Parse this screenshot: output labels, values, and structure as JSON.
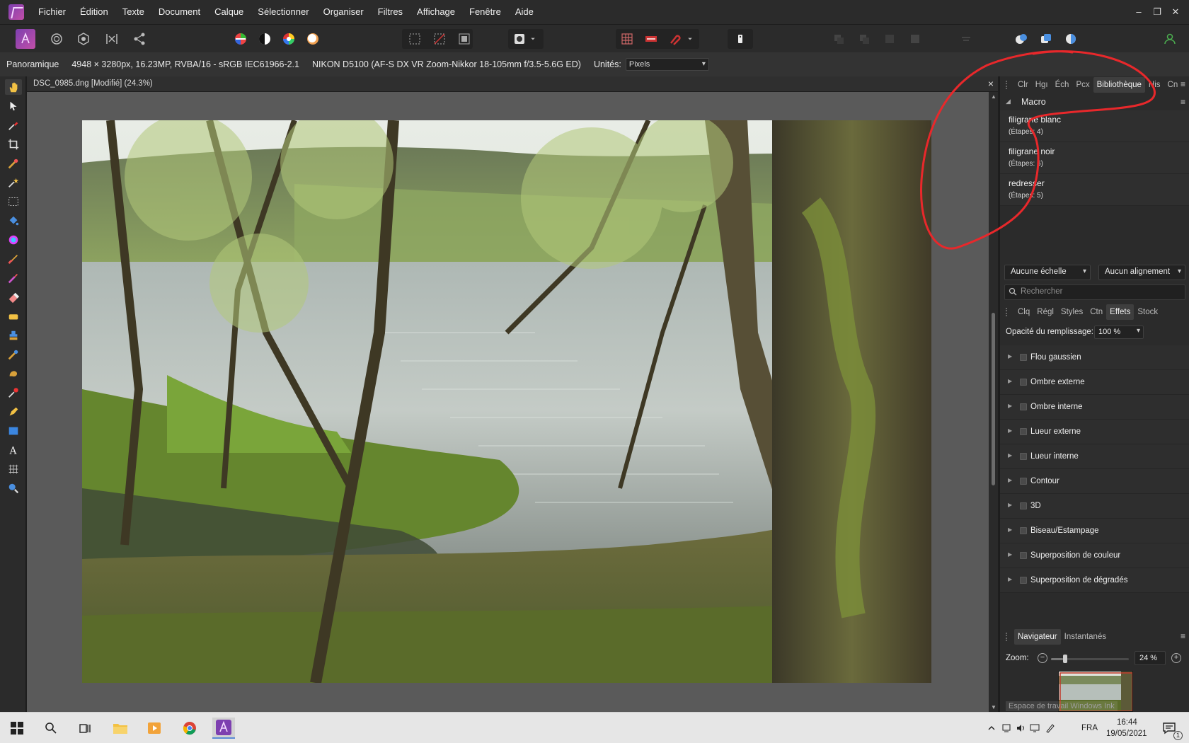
{
  "menu": {
    "items": [
      "Fichier",
      "Édition",
      "Texte",
      "Document",
      "Calque",
      "Sélectionner",
      "Organiser",
      "Filtres",
      "Affichage",
      "Fenêtre",
      "Aide"
    ]
  },
  "window_controls": {
    "minimize": "–",
    "restore": "❐",
    "close": "✕"
  },
  "context": {
    "tool_name": "Panoramique",
    "image_info": "4948 × 3280px, 16.23MP, RVBA/16 - sRGB IEC61966-2.1",
    "camera_info": "NIKON D5100 (AF-S DX VR Zoom-Nikkor 18-105mm f/3.5-5.6G ED)",
    "units_label": "Unités:",
    "units_value": "Pixels"
  },
  "document": {
    "title": "DSC_0985.dng [Modifié] (24.3%)",
    "close": "×"
  },
  "panels": {
    "top_tabs": [
      "Clr",
      "Hgı",
      "Éch",
      "Pcx",
      "Bibliothèque",
      "His",
      "Cn"
    ],
    "top_active": "Bibliothèque",
    "macro_title": "Macro",
    "macros": [
      {
        "name": "filigrane blanc",
        "steps": "(Étapes: 4)"
      },
      {
        "name": "filigrane noir",
        "steps": "(Étapes: 6)"
      },
      {
        "name": "redresser",
        "steps": "(Étapes: 5)"
      }
    ],
    "scale_select": "Aucune échelle",
    "align_select": "Aucun alignement",
    "search_placeholder": "Rechercher",
    "mid_tabs": [
      "Clq",
      "Régl",
      "Styles",
      "Ctn",
      "Effets",
      "Stock"
    ],
    "mid_active": "Effets",
    "fill_opacity_label": "Opacité du remplissage:",
    "fill_opacity_value": "100 %",
    "effects": [
      "Flou gaussien",
      "Ombre externe",
      "Ombre interne",
      "Lueur externe",
      "Lueur interne",
      "Contour",
      "3D",
      "Biseau/Estampage",
      "Superposition de couleur",
      "Superposition de dégradés"
    ],
    "bottom_tabs": [
      "Navigateur",
      "Instantanés"
    ],
    "bottom_active": "Navigateur",
    "zoom_label": "Zoom:",
    "zoom_value": "24 %",
    "zoom_level": 0.243,
    "workspace_label": "Espace de travail Windows Ink"
  },
  "taskbar": {
    "language": "FRA",
    "time": "16:44",
    "date": "19/05/2021",
    "notification_count": "1"
  },
  "colors": {
    "annotation": "#e8282b",
    "accent_purple": "#8a3fb5",
    "taskbar_active": "#5b8bd6"
  }
}
